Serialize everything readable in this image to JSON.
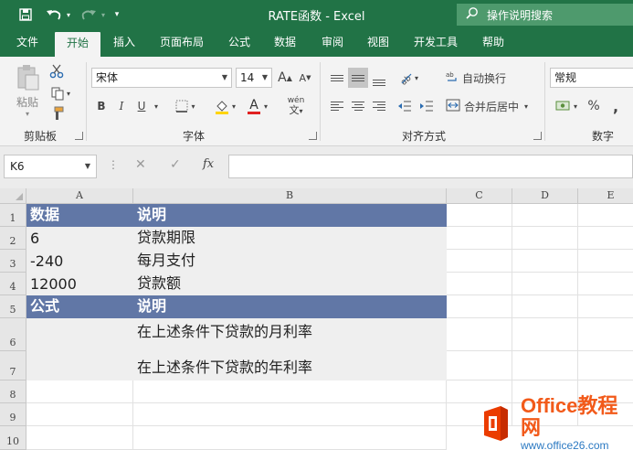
{
  "window": {
    "title": "RATE函数 - Excel",
    "tell_me": "操作说明搜索"
  },
  "tabs": [
    "文件",
    "开始",
    "插入",
    "页面布局",
    "公式",
    "数据",
    "审阅",
    "视图",
    "开发工具",
    "帮助"
  ],
  "active_tab": "开始",
  "ribbon": {
    "clipboard": {
      "paste_label": "粘贴",
      "group_label": "剪贴板"
    },
    "font": {
      "font_name": "宋体",
      "font_size": "14",
      "bold": "B",
      "italic": "I",
      "underline": "U",
      "font_color_letter": "A",
      "phonetic": "wén",
      "group_label": "字体"
    },
    "alignment": {
      "wrap_text": "自动换行",
      "merge_center": "合并后居中",
      "group_label": "对齐方式"
    },
    "number": {
      "format": "常规",
      "percent": "%",
      "group_label": "数字"
    }
  },
  "formula_bar": {
    "name_box": "K6",
    "fx_label": "fx",
    "formula": ""
  },
  "grid": {
    "columns": [
      "A",
      "B",
      "C",
      "D",
      "E"
    ],
    "rows": [
      "1",
      "2",
      "3",
      "4",
      "5",
      "6",
      "7",
      "8",
      "9",
      "10"
    ],
    "cells": {
      "A1": "数据",
      "B1": "说明",
      "A2": "6",
      "B2": "贷款期限",
      "A3": "-240",
      "B3": "每月支付",
      "A4": "12000",
      "B4": "贷款额",
      "A5": "公式",
      "B5": "说明",
      "A6": "",
      "B6": "在上述条件下贷款的月利率",
      "A7": "",
      "B7": "在上述条件下贷款的年利率"
    }
  },
  "colors": {
    "excel_green": "#217346",
    "header_fill": "#6177a6",
    "shaded_fill": "#efefef"
  },
  "watermark": {
    "brand": "Office教程网",
    "url": "www.office26.com"
  }
}
